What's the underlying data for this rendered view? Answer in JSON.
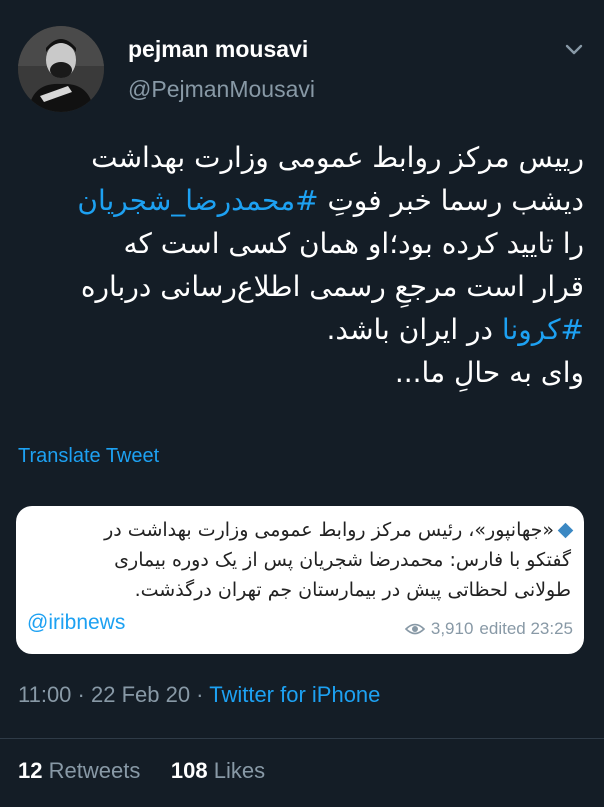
{
  "user": {
    "name": "pejman mousavi",
    "handle": "@PejmanMousavi"
  },
  "tweet": {
    "line1": "رییس مرکز روابط عمومی وزارت بهداشت",
    "line2_prefix": "دیشب رسما خبر فوتِ ",
    "line2_hashtag": "#محمدرضا_شجریان",
    "line3": "را تایید کرده بود؛او همان کسی است که",
    "line4": "قرار است مرجعِ رسمی اطلاع‌رسانی درباره",
    "line5_hashtag": "#کرونا",
    "line5_suffix": " در ایران باشد.",
    "line6": "وای به حالِ ما..."
  },
  "translate_label": "Translate Tweet",
  "quoted": {
    "line1": "«جهانپور»، رئیس مرکز روابط عمومی وزارت بهداشت در",
    "line2": "گفتکو با فارس: محمدرضا شجریان پس از یک دوره بیماری",
    "line3": "طولانی لحظاتی پیش در بیمارستان جم تهران درگذشت.",
    "handle": "@iribnews",
    "views": "3,910",
    "edited": "edited 23:25"
  },
  "meta": {
    "time": "11:00",
    "date": "22 Feb 20",
    "sep": " · ",
    "client": "Twitter for iPhone"
  },
  "stats": {
    "retweets_count": "12",
    "retweets_label": "Retweets",
    "likes_count": "108",
    "likes_label": "Likes"
  },
  "colors": {
    "background": "#141d26",
    "accent": "#1da1f2",
    "secondary_text": "#8899a6"
  }
}
